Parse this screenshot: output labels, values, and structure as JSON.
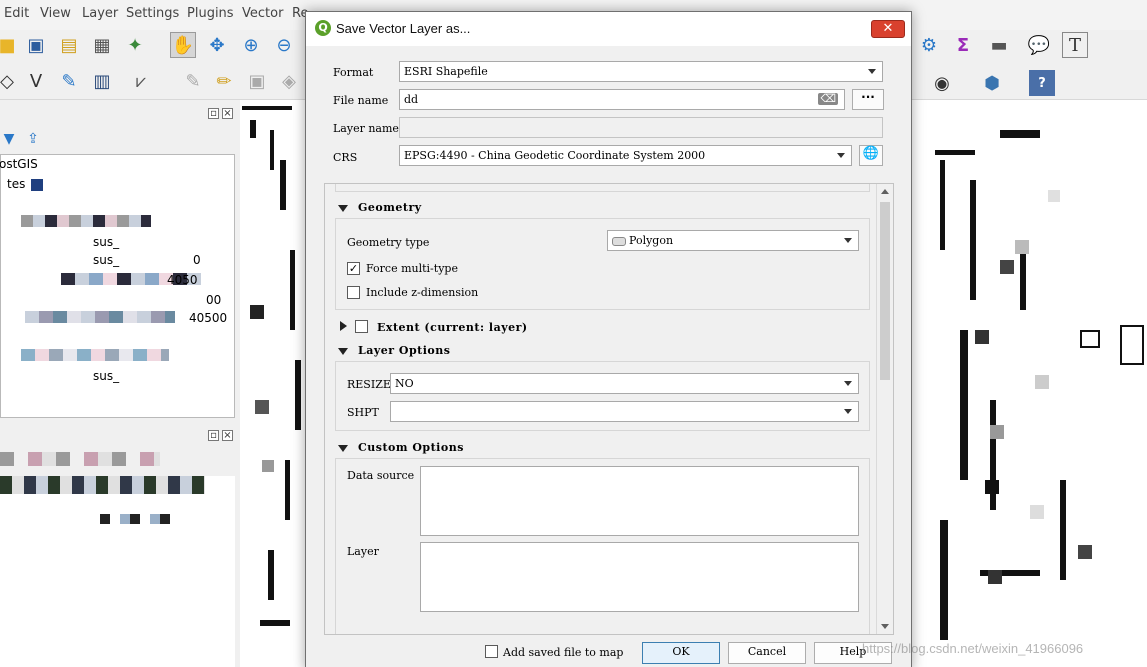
{
  "menubar": {
    "items": [
      "Edit",
      "View",
      "Layer",
      "Settings",
      "Plugins",
      "Vector",
      "Re"
    ]
  },
  "layer_panel": {
    "visible_texts": [
      "ostGIS",
      "tes",
      "sus_",
      "sus_",
      "0",
      "4050",
      "00",
      "40500",
      "sus_"
    ]
  },
  "dialog": {
    "title": "Save Vector Layer as...",
    "close_label": "✕",
    "format": {
      "label": "Format",
      "value": "ESRI Shapefile"
    },
    "file_name": {
      "label": "File name",
      "value": "dd",
      "browse_label": "···"
    },
    "layer_name": {
      "label": "Layer name",
      "value": ""
    },
    "crs": {
      "label": "CRS",
      "value": "EPSG:4490 - China Geodetic Coordinate System 2000"
    },
    "geometry": {
      "header": "Geometry",
      "type_label": "Geometry type",
      "type_value": "Polygon",
      "force_multi": {
        "label": "Force multi-type",
        "checked": true
      },
      "include_z": {
        "label": "Include z-dimension",
        "checked": false
      }
    },
    "extent": {
      "header": "Extent (current: layer)",
      "checked": false
    },
    "layer_options": {
      "header": "Layer Options",
      "resize": {
        "label": "RESIZE",
        "value": "NO"
      },
      "shpt": {
        "label": "SHPT",
        "value": ""
      }
    },
    "custom_options": {
      "header": "Custom Options",
      "data_source_label": "Data source",
      "layer_label": "Layer"
    },
    "add_to_map": {
      "label": "Add saved file to map",
      "checked": false
    },
    "buttons": {
      "ok": "OK",
      "cancel": "Cancel",
      "help": "Help"
    }
  },
  "watermark": "https://blog.csdn.net/weixin_41966096"
}
